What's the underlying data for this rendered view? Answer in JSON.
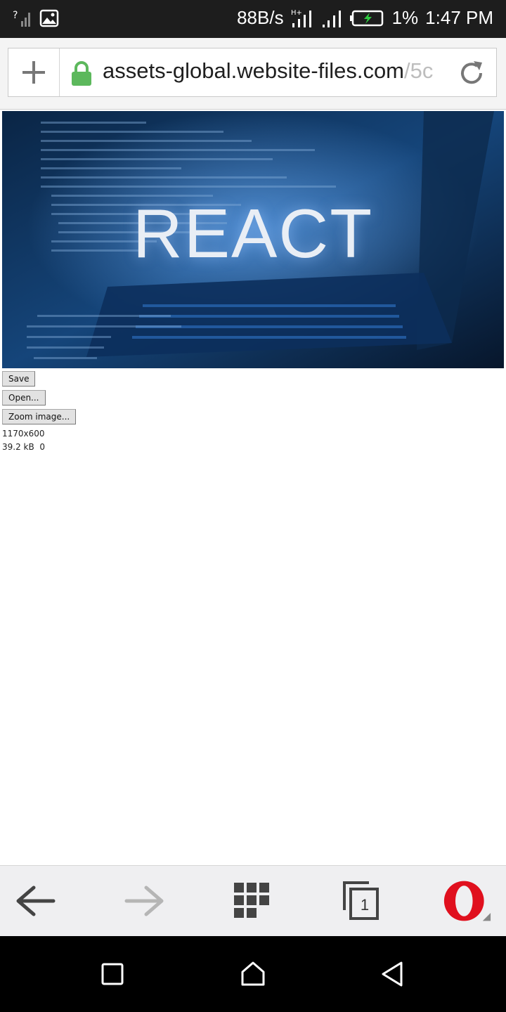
{
  "status_bar": {
    "speed": "88B/s",
    "battery_percent": "1%",
    "time": "1:47 PM",
    "icons": [
      "no-sim-signal-icon",
      "image-icon",
      "hplus-signal-icon",
      "signal-icon",
      "battery-charging-icon"
    ]
  },
  "url_bar": {
    "domain": "assets-global.website-files.com",
    "path": "/5c",
    "icons": [
      "plus-icon",
      "lock-icon",
      "reload-icon"
    ]
  },
  "content": {
    "image_title": "REACT",
    "buttons": {
      "save": "Save",
      "open": "Open...",
      "zoom": "Zoom image..."
    },
    "dimensions": "1170x600",
    "size": "39.2 kB  0"
  },
  "toolbar": {
    "tab_count": "1",
    "icons": [
      "back-arrow-icon",
      "forward-arrow-icon",
      "speed-dial-grid-icon",
      "tabs-icon",
      "opera-menu-icon"
    ]
  },
  "nav_bar": {
    "icons": [
      "recents-square-icon",
      "home-icon",
      "back-triangle-icon"
    ]
  },
  "colors": {
    "status_bar_bg": "#1d1d1d",
    "lock_green": "#5cb85c",
    "opera_red": "#e0101e",
    "battery_green": "#2ecc40"
  }
}
